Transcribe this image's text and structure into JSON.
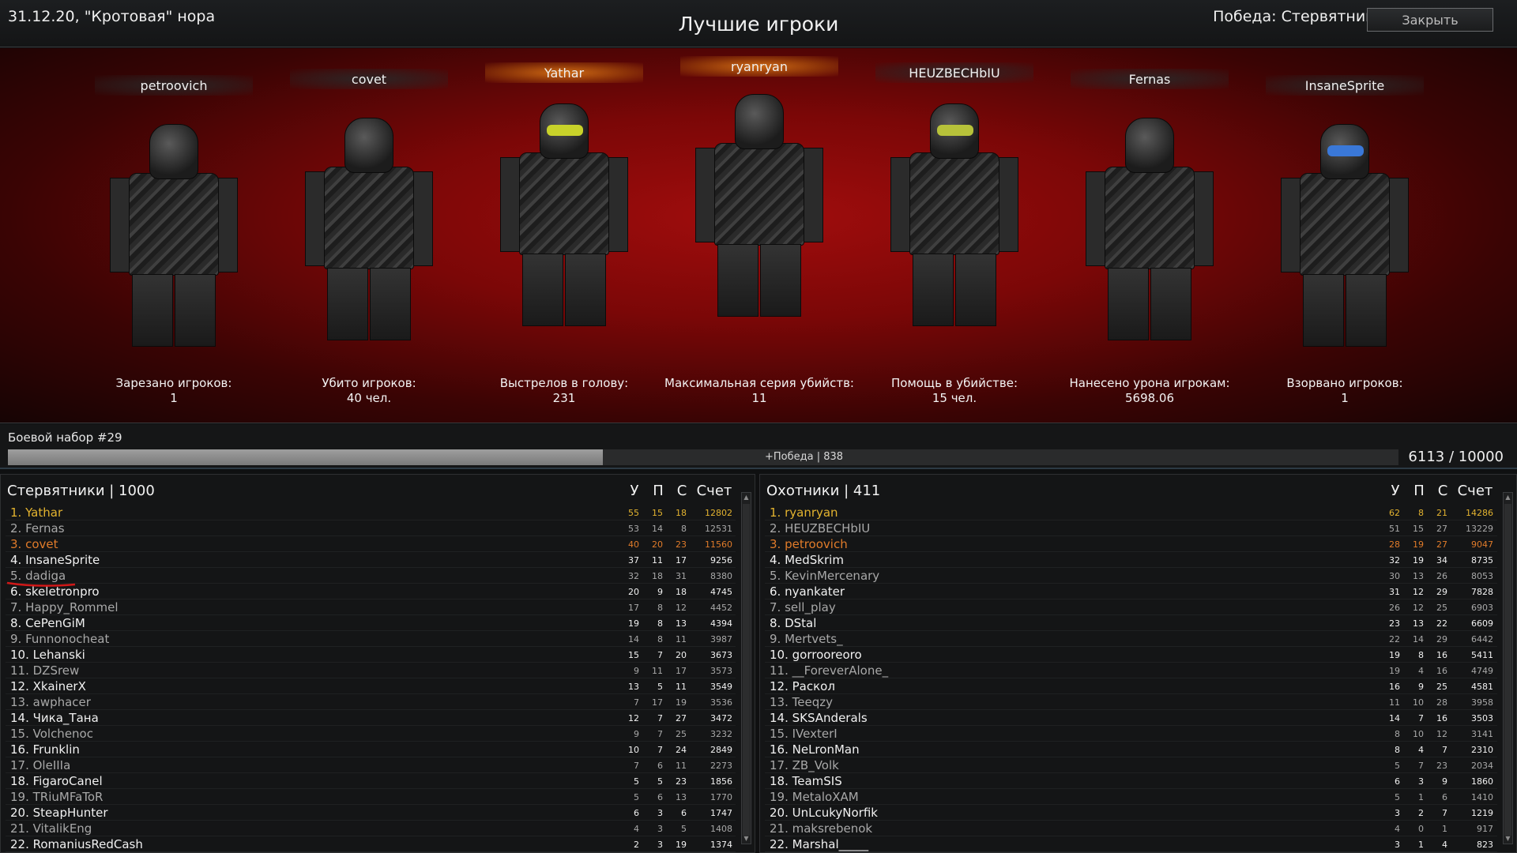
{
  "header": {
    "date_location": "31.12.20, \"Кротовая\" нора",
    "title": "Лучшие игроки",
    "victory": "Победа: Стервятники",
    "close_label": "Закрыть"
  },
  "showcase": [
    {
      "name": "petroovich",
      "label": "Зарезано игроков:",
      "value": "1"
    },
    {
      "name": "covet",
      "label": "Убито игроков:",
      "value": "40 чел."
    },
    {
      "name": "Yathar",
      "label": "Выстрелов в голову:",
      "value": "231"
    },
    {
      "name": "ryanryan",
      "label": "Максимальная серия убийств:",
      "value": "11"
    },
    {
      "name": "HEUZBECHbIU",
      "label": "Помощь в убийстве:",
      "value": "15 чел."
    },
    {
      "name": "Fernas",
      "label": "Нанесено урона игрокам:",
      "value": "5698.06"
    },
    {
      "name": "InsaneSprite",
      "label": "Взорвано игроков:",
      "value": "1"
    }
  ],
  "kit": {
    "label": "Боевой набор #29",
    "bonus": "+Победа | 838",
    "progress_text": "6113 / 10000",
    "progress_fraction": 0.6113
  },
  "columns": {
    "kills": "У",
    "deaths": "П",
    "assists": "С",
    "score": "Счет"
  },
  "teams": {
    "left": {
      "title": "Стервятники | 1000",
      "rows": [
        [
          "1. Yathar",
          "55",
          "15",
          "18",
          "12802"
        ],
        [
          "2. Fernas",
          "53",
          "14",
          "8",
          "12531"
        ],
        [
          "3. covet",
          "40",
          "20",
          "23",
          "11560"
        ],
        [
          "4. InsaneSprite",
          "37",
          "11",
          "17",
          "9256"
        ],
        [
          "5.    dadiga",
          "32",
          "18",
          "31",
          "8380"
        ],
        [
          "6. skeletronpro",
          "20",
          "9",
          "18",
          "4745"
        ],
        [
          "7. Happy_Rommel",
          "17",
          "8",
          "12",
          "4452"
        ],
        [
          "8. CePenGiM",
          "19",
          "8",
          "13",
          "4394"
        ],
        [
          "9. Funnonocheat",
          "14",
          "8",
          "11",
          "3987"
        ],
        [
          "10. Lehanski",
          "15",
          "7",
          "20",
          "3673"
        ],
        [
          "11. DZSrew",
          "9",
          "11",
          "17",
          "3573"
        ],
        [
          "12. XkainerX",
          "13",
          "5",
          "11",
          "3549"
        ],
        [
          "13. awphacer",
          "7",
          "17",
          "19",
          "3536"
        ],
        [
          "14. Чика_Тана",
          "12",
          "7",
          "27",
          "3472"
        ],
        [
          "15. Volchenoc",
          "9",
          "7",
          "25",
          "3232"
        ],
        [
          "16. Frunklin",
          "10",
          "7",
          "24",
          "2849"
        ],
        [
          "17. OleIIIa",
          "7",
          "6",
          "11",
          "2273"
        ],
        [
          "18. FigaroCanel",
          "5",
          "5",
          "23",
          "1856"
        ],
        [
          "19. TRiuMFaToR",
          "5",
          "6",
          "13",
          "1770"
        ],
        [
          "20. SteapHunter",
          "6",
          "3",
          "6",
          "1747"
        ],
        [
          "21. VitalikEng",
          "4",
          "3",
          "5",
          "1408"
        ],
        [
          "22. RomaniusRedCash",
          "2",
          "3",
          "19",
          "1374"
        ]
      ]
    },
    "right": {
      "title": "Охотники | 411",
      "rows": [
        [
          "1. ryanryan",
          "62",
          "8",
          "21",
          "14286"
        ],
        [
          "2. HEUZBECHbIU",
          "51",
          "15",
          "27",
          "13229"
        ],
        [
          "3. petroovich",
          "28",
          "19",
          "27",
          "9047"
        ],
        [
          "4. MedSkrim",
          "32",
          "19",
          "34",
          "8735"
        ],
        [
          "5. KevinMercenary",
          "30",
          "13",
          "26",
          "8053"
        ],
        [
          "6. nyankater",
          "31",
          "12",
          "29",
          "7828"
        ],
        [
          "7. sell_play",
          "26",
          "12",
          "25",
          "6903"
        ],
        [
          "8. DStal",
          "23",
          "13",
          "22",
          "6609"
        ],
        [
          "9. Mertvets_",
          "22",
          "14",
          "29",
          "6442"
        ],
        [
          "10. gorrooreoro",
          "19",
          "8",
          "16",
          "5411"
        ],
        [
          "11. __ForeverAlone_",
          "19",
          "4",
          "16",
          "4749"
        ],
        [
          "12. Раскол",
          "16",
          "9",
          "25",
          "4581"
        ],
        [
          "13. Teeqzy",
          "11",
          "10",
          "28",
          "3958"
        ],
        [
          "14. SKSAnderals",
          "14",
          "7",
          "16",
          "3503"
        ],
        [
          "15. IVexterI",
          "8",
          "10",
          "12",
          "3141"
        ],
        [
          "16. NeLronMan",
          "8",
          "4",
          "7",
          "2310"
        ],
        [
          "17. ZB_Volk",
          "5",
          "7",
          "23",
          "2034"
        ],
        [
          "18. TeamSIS",
          "6",
          "3",
          "9",
          "1860"
        ],
        [
          "19. MetaloXAM",
          "5",
          "1",
          "6",
          "1410"
        ],
        [
          "20. UnLcukyNorfik",
          "3",
          "2",
          "7",
          "1219"
        ],
        [
          "21. maksrebenok",
          "4",
          "0",
          "1",
          "917"
        ],
        [
          "22. Marshal_____",
          "3",
          "1",
          "4",
          "823"
        ]
      ]
    }
  },
  "colors": {
    "gold": "#e3b32f",
    "orange": "#e07b2a",
    "showcase_red": "#a10d0d"
  }
}
